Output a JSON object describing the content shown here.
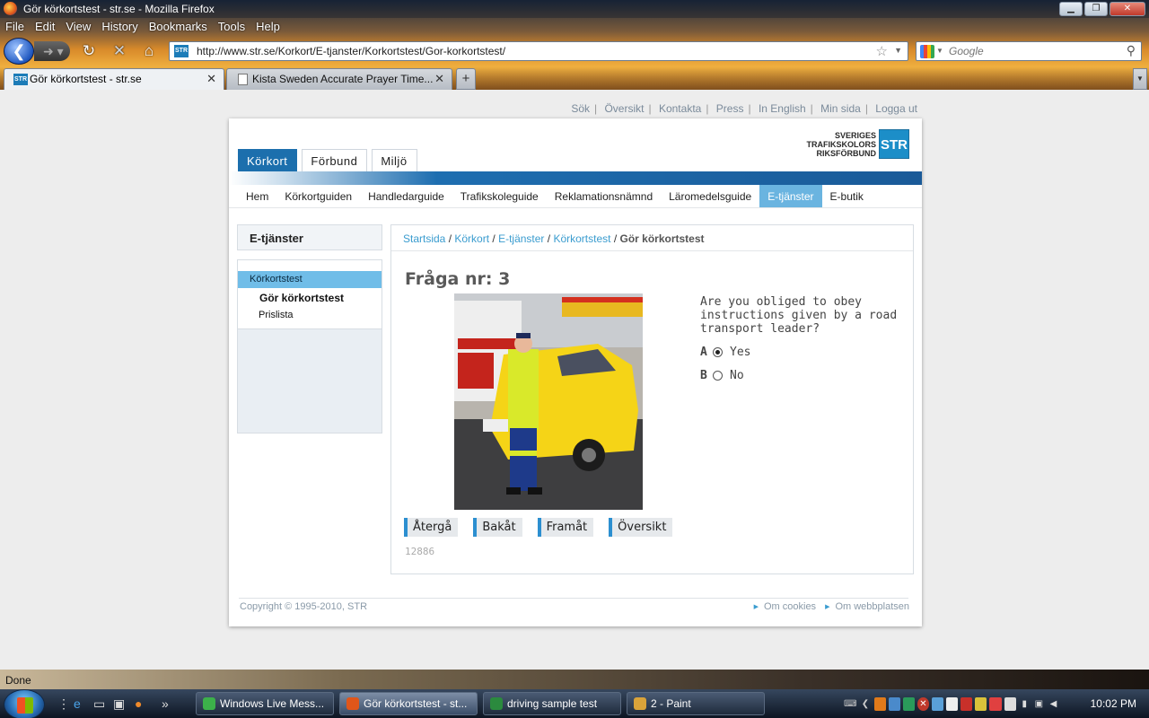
{
  "window": {
    "title": "Gör körkortstest - str.se - Mozilla Firefox",
    "buttons": [
      "▁",
      "❐",
      "✕"
    ]
  },
  "menubar": [
    "File",
    "Edit",
    "View",
    "History",
    "Bookmarks",
    "Tools",
    "Help"
  ],
  "navbar": {
    "url": "http://www.str.se/Korkort/E-tjanster/Korkortstest/Gor-korkortstest/",
    "search_placeholder": "Google"
  },
  "tabs": [
    {
      "label": "Gör körkortstest - str.se",
      "favicon": "STR",
      "active": true
    },
    {
      "label": "Kista Sweden Accurate Prayer Time...",
      "active": false
    }
  ],
  "site": {
    "top_links": [
      "Sök",
      "Översikt",
      "Kontakta",
      "Press",
      "In English",
      "Min sida",
      "Logga ut"
    ],
    "logo_lines": [
      "SVERIGES",
      "TRAFIKSKOLORS",
      "RIKSFÖRBUND"
    ],
    "logo_box": "STR",
    "main_tabs": [
      "Körkort",
      "Förbund",
      "Miljö"
    ],
    "main_tab_selected": "Körkort",
    "subnav": [
      "Hem",
      "Körkortguiden",
      "Handledarguide",
      "Trafikskoleguide",
      "Reklamationsnämnd",
      "Läromedelsguide",
      "E-tjänster",
      "E-butik"
    ],
    "subnav_selected": "E-tjänster",
    "sidebar": {
      "title": "E-tjänster",
      "category": "Körkortstest",
      "current": "Gör körkortstest",
      "other": "Prislista"
    },
    "breadcrumb": {
      "items": [
        "Startsida",
        "Körkort",
        "E-tjänster",
        "Körkortstest"
      ],
      "current": "Gör körkortstest"
    },
    "question": {
      "title": "Fråga nr: 3",
      "text": "Are you obliged to obey instructions given by a road transport leader?",
      "answers": [
        {
          "letter": "A",
          "text": "Yes",
          "selected": true
        },
        {
          "letter": "B",
          "text": "No",
          "selected": false
        }
      ],
      "buttons": [
        "Återgå",
        "Bakåt",
        "Framåt",
        "Översikt"
      ],
      "id": "12886"
    },
    "footer": {
      "copyright": "Copyright © 1995-2010, STR",
      "links": [
        "Om cookies",
        "Om webbplatsen"
      ]
    }
  },
  "statusbar": {
    "text": "Done"
  },
  "taskbar": {
    "buttons": [
      {
        "label": "Windows Live Mess...",
        "color": "#3cb04a"
      },
      {
        "label": "Gör körkortstest - st...",
        "color": "#e0561a",
        "active": true
      },
      {
        "label": "driving sample test",
        "color": "#2b8a3e"
      },
      {
        "label": "2 - Paint",
        "color": "#d9a33a"
      }
    ],
    "clock": "10:02 PM"
  },
  "colors": {
    "brand_blue": "#1c6fad",
    "link_blue": "#3a9ccf",
    "selected_subnav": "#6ab4e0"
  }
}
